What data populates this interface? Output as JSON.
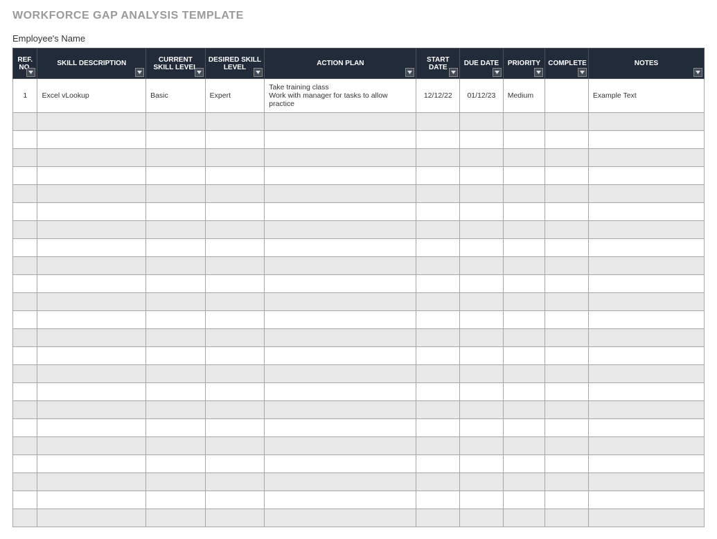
{
  "title": "WORKFORCE GAP ANALYSIS TEMPLATE",
  "subtitle": "Employee's Name",
  "columns": {
    "ref_no": "REF. NO.",
    "skill_description": "SKILL DESCRIPTION",
    "current_skill_level": "CURRENT SKILL LEVEL",
    "desired_skill_level": "DESIRED SKILL LEVEL",
    "action_plan": "ACTION PLAN",
    "start_date": "START DATE",
    "due_date": "DUE DATE",
    "priority": "PRIORITY",
    "complete": "COMPLETE",
    "notes": "NOTES"
  },
  "rows": [
    {
      "ref_no": "1",
      "skill_description": "Excel vLookup",
      "current_skill_level": "Basic",
      "desired_skill_level": "Expert",
      "action_plan": "Take training class\nWork with manager for tasks to allow practice",
      "start_date": "12/12/22",
      "due_date": "01/12/23",
      "priority": "Medium",
      "complete": "",
      "notes": "Example Text"
    }
  ],
  "empty_row_count": 23
}
